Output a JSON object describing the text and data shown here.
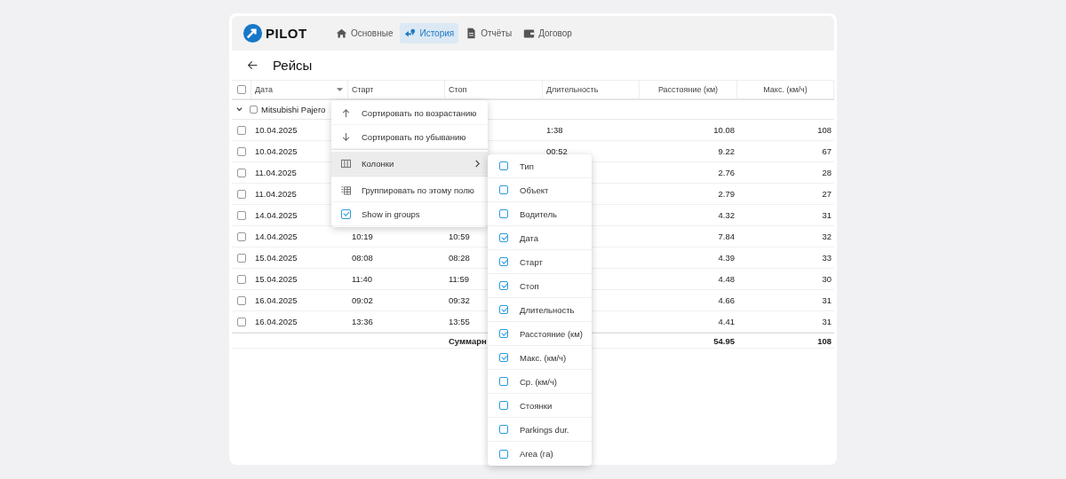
{
  "header": {
    "logo": "PILOT",
    "nav": [
      {
        "label": "Основные",
        "kind": "home",
        "selected": false
      },
      {
        "label": "История",
        "kind": "route",
        "selected": true
      },
      {
        "label": "Отчёты",
        "kind": "document",
        "selected": false
      },
      {
        "label": "Договор",
        "kind": "wallet",
        "selected": false
      }
    ]
  },
  "page": {
    "title": "Рейсы"
  },
  "table": {
    "all_checked": false,
    "columns": [
      {
        "label": "Дата"
      },
      {
        "label": "Старт"
      },
      {
        "label": "Стоп"
      },
      {
        "label": "Длительность"
      },
      {
        "label": "Расстояние (км)"
      },
      {
        "label": "Макс. (км/ч)"
      }
    ],
    "group": {
      "label": "Mitsubishi Pajero",
      "expanded": true,
      "checked": false
    },
    "rows": [
      {
        "checked": false,
        "cells": [
          "10.04.2025",
          "",
          "",
          "1:38",
          "10.08",
          "108"
        ]
      },
      {
        "checked": false,
        "cells": [
          "10.04.2025",
          "",
          "",
          "00:52",
          "9.22",
          "67"
        ]
      },
      {
        "checked": false,
        "cells": [
          "11.04.2025",
          "",
          "",
          "",
          "2.76",
          "28"
        ]
      },
      {
        "checked": false,
        "cells": [
          "11.04.2025",
          "",
          "",
          "",
          "2.79",
          "27"
        ]
      },
      {
        "checked": false,
        "cells": [
          "14.04.2025",
          "",
          "",
          "",
          "4.32",
          "31"
        ]
      },
      {
        "checked": false,
        "cells": [
          "14.04.2025",
          "10:19",
          "10:59",
          "",
          "7.84",
          "32"
        ]
      },
      {
        "checked": false,
        "cells": [
          "15.04.2025",
          "08:08",
          "08:28",
          "",
          "4.39",
          "33"
        ]
      },
      {
        "checked": false,
        "cells": [
          "15.04.2025",
          "11:40",
          "11:59",
          "",
          "4.48",
          "30"
        ]
      },
      {
        "checked": false,
        "cells": [
          "16.04.2025",
          "09:02",
          "09:32",
          "",
          "4.66",
          "31"
        ]
      },
      {
        "checked": false,
        "cells": [
          "16.04.2025",
          "13:36",
          "13:55",
          "",
          "4.41",
          "31"
        ]
      }
    ],
    "summary": {
      "label": "Суммарн",
      "distance": "54.95",
      "max": "108"
    }
  },
  "column_menu": {
    "items": [
      {
        "kind": "sort-asc",
        "label": "Сортировать по возрастанию",
        "selected": false
      },
      {
        "kind": "sort-desc",
        "label": "Сортировать по убыванию",
        "selected": false
      },
      {
        "kind": "columns",
        "label": "Колонки",
        "selected": true
      },
      {
        "kind": "group",
        "label": "Группировать по этому полю",
        "selected": false
      },
      {
        "kind": "toggle",
        "label": "Show in groups",
        "checked": true,
        "selected": false
      }
    ],
    "submenu": [
      {
        "label": "Тип",
        "checked": false
      },
      {
        "label": "Объект",
        "checked": false
      },
      {
        "label": "Водитель",
        "checked": false
      },
      {
        "label": "Дата",
        "checked": true
      },
      {
        "label": "Старт",
        "checked": true
      },
      {
        "label": "Стоп",
        "checked": true
      },
      {
        "label": "Длительность",
        "checked": true
      },
      {
        "label": "Расстояние (км)",
        "checked": true
      },
      {
        "label": "Макс. (км/ч)",
        "checked": true
      },
      {
        "label": "Ср. (км/ч)",
        "checked": false
      },
      {
        "label": "Стоянки",
        "checked": false
      },
      {
        "label": "Parkings dur.",
        "checked": false
      },
      {
        "label": "Area (га)",
        "checked": false
      }
    ]
  }
}
